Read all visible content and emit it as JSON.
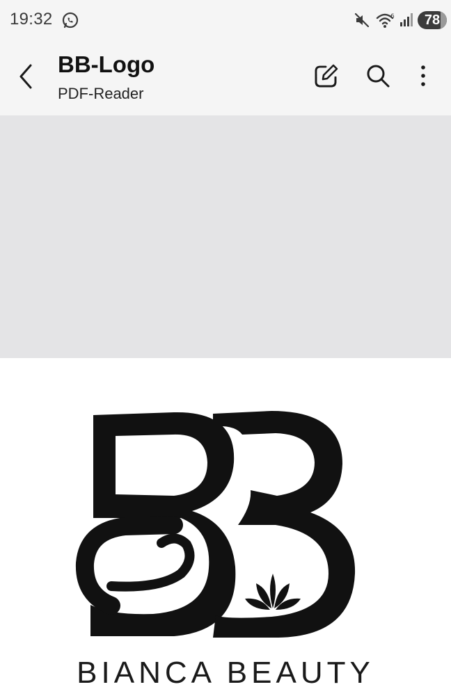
{
  "status_bar": {
    "time": "19:32",
    "battery_level": "78",
    "battery_fraction": 0.78,
    "icons": [
      "whatsapp-icon",
      "mute-icon",
      "wifi-icon",
      "signal-icon"
    ]
  },
  "app_bar": {
    "title": "BB-Logo",
    "subtitle": "PDF-Reader",
    "icons": [
      "back-icon",
      "edit-icon",
      "search-icon",
      "more-icon"
    ]
  },
  "document": {
    "logo_text": "BIANCA BEAUTY",
    "logo_mark_letters": "BB"
  },
  "colors": {
    "background": "#f5f5f5",
    "viewer_gray": "#e4e4e6",
    "page": "#ffffff",
    "ink": "#111111"
  }
}
